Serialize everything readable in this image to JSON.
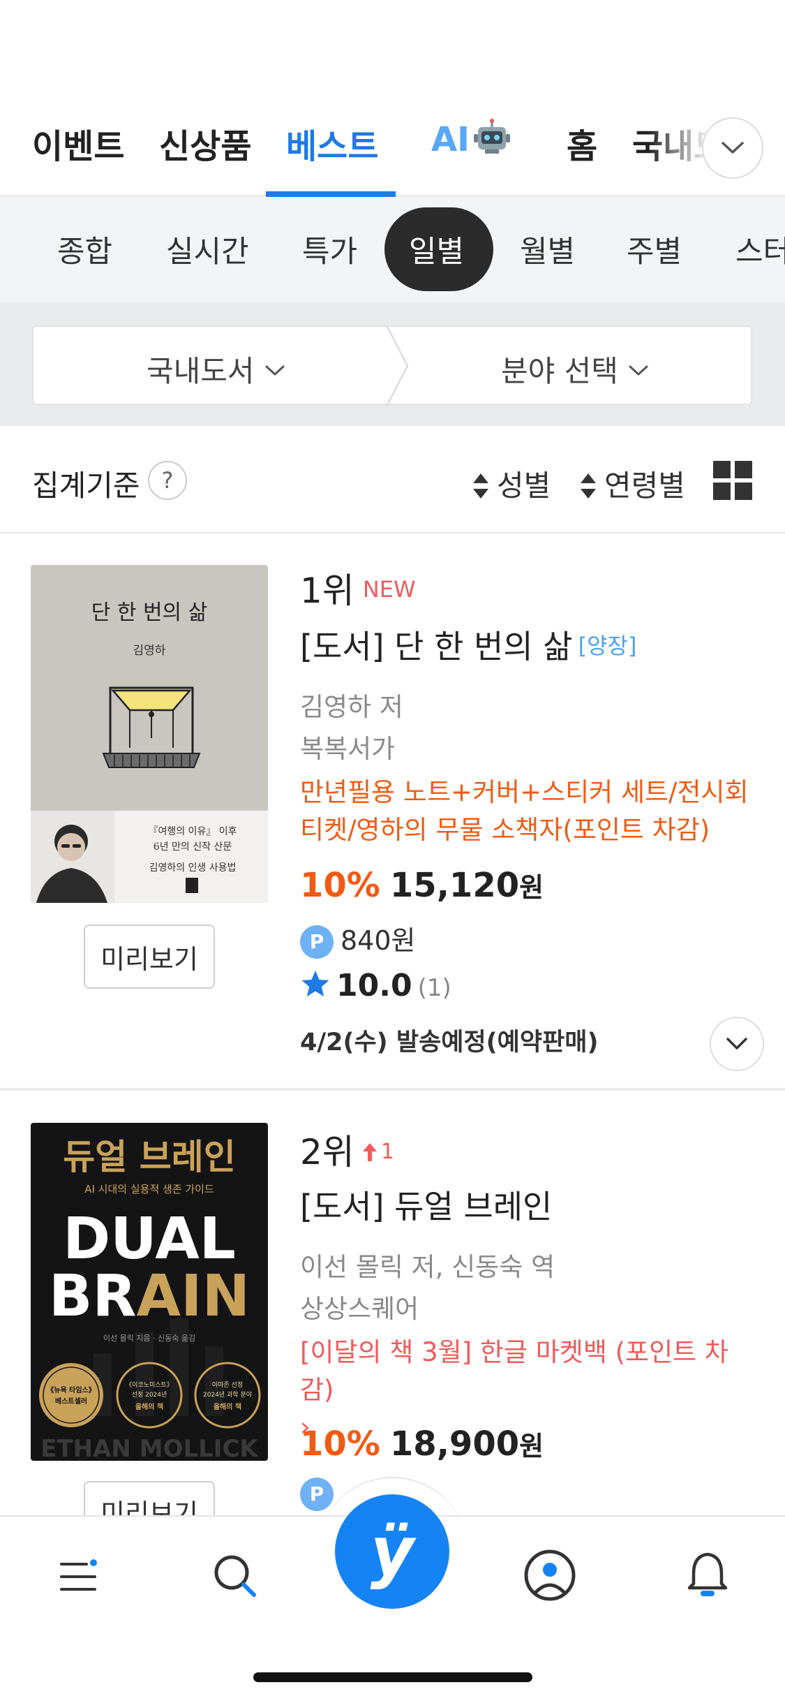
{
  "top_tabs": {
    "items": [
      "이벤트",
      "신상품",
      "베스트",
      "AI",
      "홈",
      "국내도"
    ],
    "active": "베스트"
  },
  "sub_tabs": {
    "items": [
      "종합",
      "실시간",
      "특가",
      "일별",
      "월별",
      "주별",
      "스터"
    ],
    "active": "일별"
  },
  "filters": {
    "category": "국내도서",
    "field": "분야 선택"
  },
  "aggregation": {
    "label": "집계기준",
    "help": "?",
    "sort_gender": "성별",
    "sort_age": "연령별"
  },
  "books": [
    {
      "rank": "1위",
      "rank_badge": "NEW",
      "title": "[도서] 단 한 번의 삶",
      "binding": "[양장]",
      "author": "김영하 저",
      "publisher": "복복서가",
      "promo": "만년필용 노트+커버+스티커 세트/전시회 티켓/영하의 무물 소책자(포인트 차감)",
      "discount": "10%",
      "price": "15,120",
      "won": "원",
      "points": "840원",
      "point_badge": "P",
      "rating": "10.0",
      "rating_count": "(1)",
      "shipping": "4/2(수) 발송예정(예약판매)",
      "preview": "미리보기",
      "cover": {
        "title": "단 한 번의 삶",
        "author": "김영하",
        "line1": "『여행의 이유』 이후",
        "line2": "6년 만의 신작 산문",
        "line3": "김영하의 인생 사용법",
        "colors": {
          "top": "#c9c6c0",
          "bottom": "#f2f1ee"
        }
      }
    },
    {
      "rank": "2위",
      "rank_change": "1",
      "title": "[도서] 듀얼 브레인",
      "author": "이선 몰릭 저, 신동숙 역",
      "publisher": "상상스퀘어",
      "promo": "[이달의 책 3월] 한글 마켓백 (포인트 차감)",
      "promo_arrow": "›",
      "discount": "10%",
      "price": "18,900",
      "won": "원",
      "point_badge": "P",
      "preview": "미리보기",
      "cover": {
        "korean_title": "듀얼 브레인",
        "subtitle": "AI 시대의 실용적 생존 가이드",
        "title_line1": "DUAL",
        "title_line2_a": "BR",
        "title_line2_b": "AIN",
        "author_line": "ETHAN MOLLICK",
        "credits": "이선 몰릭 지음 · 신동숙 옮김",
        "seal1_line1": "《뉴욕 타임스》",
        "seal1_line2": "베스트셀러",
        "seal2_line1": "《이코노미스트》",
        "seal2_line2": "선정 2024년",
        "seal2_line3": "올해의 책",
        "seal3_line1": "아마존 선정",
        "seal3_line2": "2024년 과학 분야",
        "seal3_line3": "올해의 책",
        "colors": {
          "bg": "#141414",
          "gold": "#c9a25a"
        }
      }
    }
  ],
  "bottom_nav": {
    "items": [
      "menu-icon",
      "search-icon",
      "yes24-home-icon",
      "profile-icon",
      "notification-icon"
    ],
    "center_glyph": "ÿ"
  },
  "colors": {
    "accent": "#1e7ae6",
    "discount": "#f25a14",
    "promo": "#ee5c14",
    "badge_new": "#f25b5b"
  }
}
